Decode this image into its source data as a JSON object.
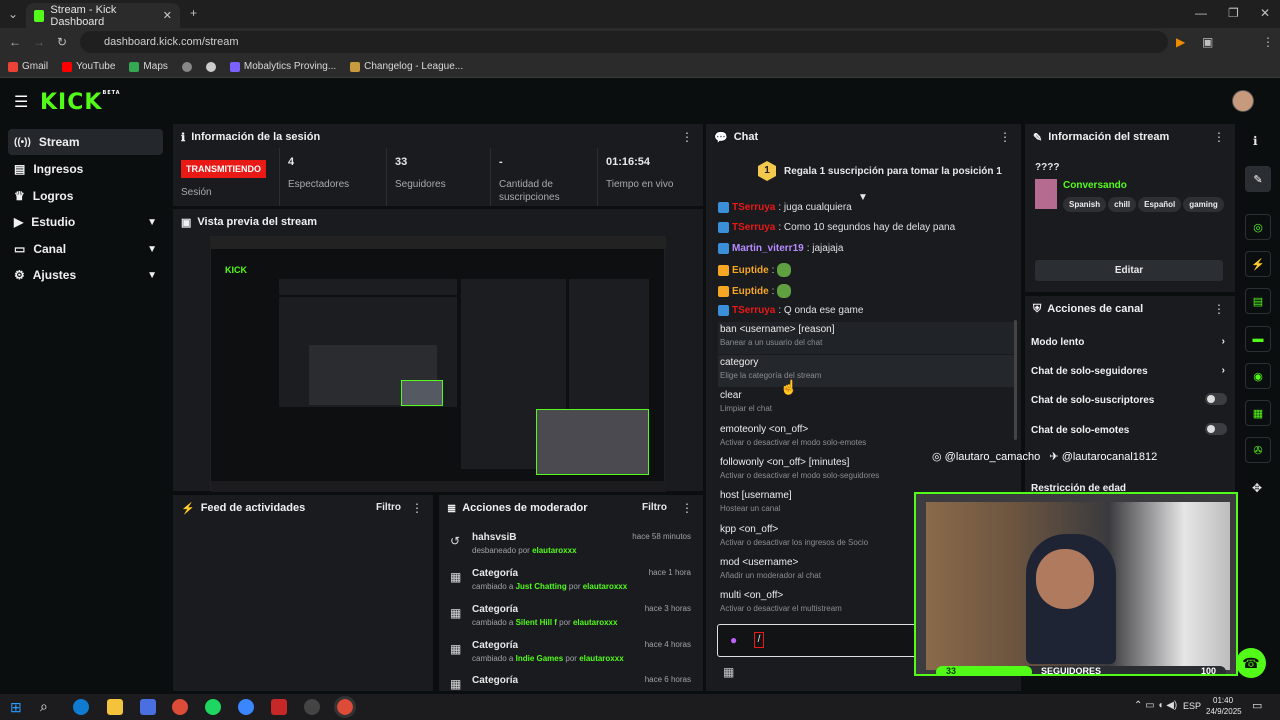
{
  "browser": {
    "tab_title": "Stream - Kick Dashboard",
    "url": "dashboard.kick.com/stream",
    "bookmarks": [
      "Gmail",
      "YouTube",
      "Maps",
      "Mobalytics Proving...",
      "Changelog - League..."
    ]
  },
  "brand": {
    "logo": "KICK",
    "beta": "BETA",
    "accent": "#53fc18"
  },
  "sidebar": {
    "items": [
      {
        "label": "Stream",
        "icon": "broadcast-icon"
      },
      {
        "label": "Ingresos",
        "icon": "dollar-icon"
      },
      {
        "label": "Logros",
        "icon": "trophy-icon"
      },
      {
        "label": "Estudio",
        "icon": "video-icon"
      },
      {
        "label": "Canal",
        "icon": "monitor-icon"
      },
      {
        "label": "Ajustes",
        "icon": "gear-icon"
      }
    ]
  },
  "session": {
    "title": "Información de la sesión",
    "status": "TRANSMITIENDO",
    "status_label": "Sesión",
    "stats": [
      {
        "value": "4",
        "label": "Espectadores"
      },
      {
        "value": "33",
        "label": "Seguidores"
      },
      {
        "value": "-",
        "label": "Cantidad de suscripciones"
      },
      {
        "value": "01:16:54",
        "label": "Tiempo en vivo"
      }
    ]
  },
  "preview": {
    "title": "Vista previa del stream"
  },
  "activity": {
    "title": "Feed de actividades",
    "filter": "Filtro"
  },
  "modactions": {
    "title": "Acciones de moderador",
    "filter": "Filtro",
    "items": [
      {
        "title": "hahsvsiB",
        "pre": "desbaneado por ",
        "who": "elautaroxxx",
        "mid": "",
        "by": "",
        "time": "hace 58 minutos",
        "icon": "undo-icon"
      },
      {
        "title": "Categoría",
        "pre": "cambiado a ",
        "who": "Just Chatting",
        "mid": " por ",
        "by": "elautaroxxx",
        "time": "hace 1 hora",
        "icon": "category-icon"
      },
      {
        "title": "Categoría",
        "pre": "cambiado a ",
        "who": "Silent Hill f",
        "mid": " por ",
        "by": "elautaroxxx",
        "time": "hace 3 horas",
        "icon": "category-icon"
      },
      {
        "title": "Categoría",
        "pre": "cambiado a ",
        "who": "Indie Games",
        "mid": " por ",
        "by": "elautaroxxx",
        "time": "hace 4 horas",
        "icon": "category-icon"
      },
      {
        "title": "Categoría",
        "pre": "",
        "who": "",
        "mid": "",
        "by": "",
        "time": "hace 6 horas",
        "icon": "category-icon"
      }
    ]
  },
  "chat": {
    "title": "Chat",
    "rank": "1",
    "sub_prompt": "Regala 1 suscripción para tomar la posición 1",
    "messages": [
      {
        "user": "TSerruya",
        "color": "#e91916",
        "text": ": juga cualquiera"
      },
      {
        "user": "TSerruya",
        "color": "#e91916",
        "text": ": Como 10 segundos hay de delay pana"
      },
      {
        "user": "Martin_viterr19",
        "color": "#b68cff",
        "text": ": jajajaja"
      },
      {
        "user": "Euptide",
        "color": "#f5a623",
        "text": ":"
      },
      {
        "user": "Euptide",
        "color": "#f5a623",
        "text": ":"
      },
      {
        "user": "TSerruya",
        "color": "#e91916",
        "text": ": Q onda ese game"
      }
    ],
    "commands": [
      {
        "cmd": "ban <username> [reason]",
        "desc": "Banear a un usuario del chat"
      },
      {
        "cmd": "category",
        "desc": "Elige la categoría del stream"
      },
      {
        "cmd": "clear",
        "desc": "Limpiar el chat"
      },
      {
        "cmd": "emoteonly <on_off>",
        "desc": "Activar o desactivar el modo solo-emotes"
      },
      {
        "cmd": "followonly <on_off> [minutes]",
        "desc": "Activar o desactivar el modo solo-seguidores"
      },
      {
        "cmd": "host [username]",
        "desc": "Hostear un canal"
      },
      {
        "cmd": "kpp <on_off>",
        "desc": "Activar o desactivar los ingresos de Socio"
      },
      {
        "cmd": "mod <username>",
        "desc": "Añadir un moderador al chat"
      },
      {
        "cmd": "multi <on_off>",
        "desc": "Activar o desactivar el multistream"
      }
    ],
    "input_value": "/"
  },
  "streaminfo": {
    "title": "Información del stream",
    "stream_title": "????",
    "category": "Conversando",
    "tags": [
      "Spanish",
      "chill",
      "Español",
      "gaming"
    ],
    "edit": "Editar"
  },
  "channelactions": {
    "title": "Acciones de canal",
    "items": [
      {
        "label": "Modo lento",
        "kind": "arrow"
      },
      {
        "label": "Chat de solo-seguidores",
        "kind": "arrow"
      },
      {
        "label": "Chat de solo-suscriptores",
        "kind": "toggle"
      },
      {
        "label": "Chat de solo-emotes",
        "kind": "toggle"
      },
      {
        "label": "Restricción de edad",
        "kind": "arrow"
      }
    ]
  },
  "overlay": {
    "instagram": "@lautaro_camacho",
    "twitter": "@lautarocanal1812",
    "follower_current": "33",
    "follower_label": "SEGUIDORES",
    "follower_goal": "100",
    "follower_progress": 0.33
  },
  "taskbar": {
    "lang": "ESP",
    "time": "01:40",
    "date": "24/9/2025"
  }
}
